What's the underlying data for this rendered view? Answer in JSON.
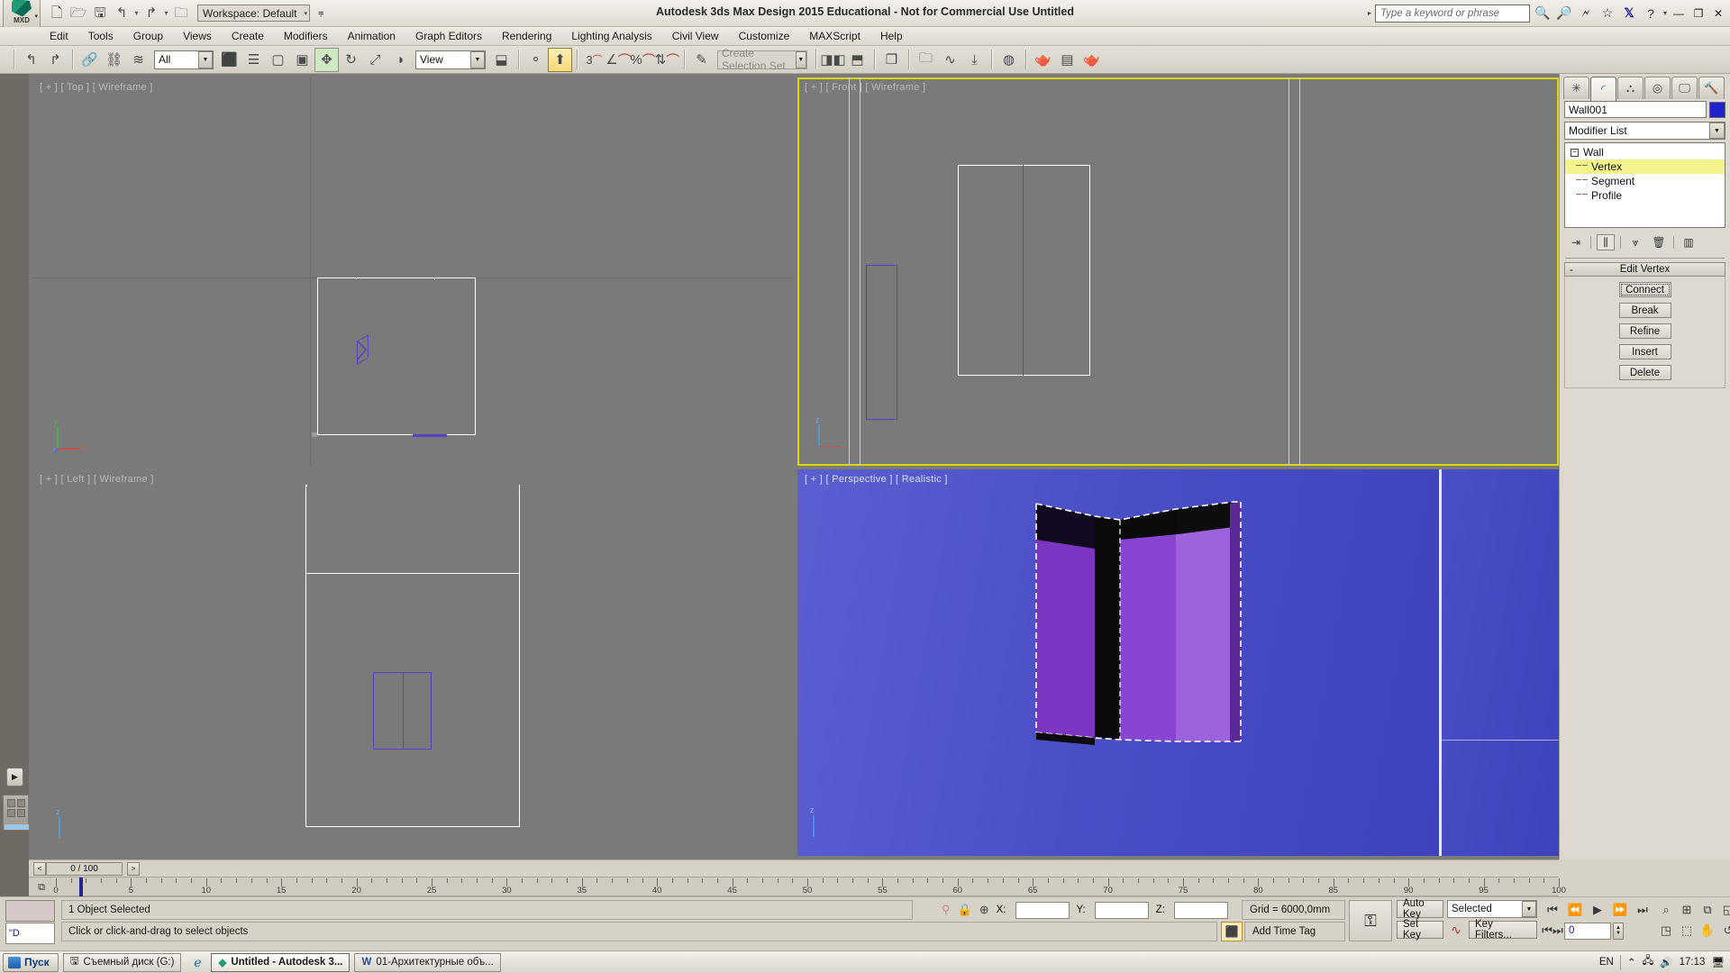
{
  "window": {
    "title": "Autodesk 3ds Max Design 2015  Educational - Not for Commercial Use   Untitled",
    "app_button_label": "MXD",
    "workspace_label": "Workspace: Default",
    "search_placeholder": "Type a keyword or phrase",
    "minimize": "—",
    "restore": "❐",
    "close": "✕"
  },
  "menu": {
    "items": [
      {
        "label": "Edit"
      },
      {
        "label": "Tools"
      },
      {
        "label": "Group"
      },
      {
        "label": "Views"
      },
      {
        "label": "Create"
      },
      {
        "label": "Modifiers"
      },
      {
        "label": "Animation"
      },
      {
        "label": "Graph Editors"
      },
      {
        "label": "Rendering"
      },
      {
        "label": "Lighting Analysis"
      },
      {
        "label": "Civil View"
      },
      {
        "label": "Customize"
      },
      {
        "label": "MAXScript"
      },
      {
        "label": "Help"
      }
    ]
  },
  "quick_access": {
    "new_icon": "new-file-icon",
    "open_icon": "open-folder-icon",
    "save_icon": "save-icon",
    "undo_icon": "undo-arrow-icon",
    "redo_icon": "redo-arrow-icon",
    "project_icon": "set-project-folder-icon"
  },
  "toolbar": {
    "selection_filter_value": "All",
    "reference_coordinate_value": "View",
    "named_selection_set_placeholder": "Create Selection Set",
    "snap_degrees": "3",
    "snap_percent": "%",
    "buttons": [
      {
        "name": "undo-button",
        "glyph": "↶"
      },
      {
        "name": "redo-button",
        "glyph": "↷"
      },
      {
        "name": "select-and-link-button",
        "glyph": "⚭"
      },
      {
        "name": "unlink-selection-button",
        "glyph": "⚭"
      },
      {
        "name": "bind-to-space-warp-button",
        "glyph": "≈"
      },
      {
        "name": "select-object-button",
        "glyph": "⬜"
      },
      {
        "name": "select-by-name-button",
        "glyph": "☰"
      },
      {
        "name": "rectangular-selection-region-button",
        "glyph": "⬚"
      },
      {
        "name": "window-crossing-button",
        "glyph": "▣"
      },
      {
        "name": "select-and-move-button",
        "glyph": "✥"
      },
      {
        "name": "select-and-rotate-button",
        "glyph": "↻"
      },
      {
        "name": "select-and-scale-button",
        "glyph": "⤢"
      },
      {
        "name": "use-center-flyout-button",
        "glyph": "◑"
      },
      {
        "name": "select-and-manipulate-button",
        "glyph": "⬤"
      },
      {
        "name": "snaps-toggle-button",
        "glyph": "⍉"
      },
      {
        "name": "angle-snap-toggle-button",
        "glyph": "∠"
      },
      {
        "name": "percent-snap-toggle-button",
        "glyph": "%"
      },
      {
        "name": "spinner-snap-toggle-button",
        "glyph": "⇅"
      },
      {
        "name": "edit-named-selection-sets-button",
        "glyph": "✎"
      },
      {
        "name": "mirror-button",
        "glyph": "▷◁"
      },
      {
        "name": "align-button",
        "glyph": "≡"
      },
      {
        "name": "layer-explorer-button",
        "glyph": "❐"
      },
      {
        "name": "scene-explorer-button",
        "glyph": "☷"
      },
      {
        "name": "curve-editor-button",
        "glyph": "∿"
      },
      {
        "name": "schematic-view-button",
        "glyph": "☰"
      },
      {
        "name": "material-editor-button",
        "glyph": "◎"
      },
      {
        "name": "render-setup-button",
        "glyph": "⛉"
      },
      {
        "name": "rendered-frame-window-button",
        "glyph": "▧"
      },
      {
        "name": "render-production-button",
        "glyph": "☕"
      }
    ]
  },
  "viewports": [
    {
      "name": "viewport-top",
      "label": "[ + ] [ Top ] [ Wireframe ]",
      "active": false
    },
    {
      "name": "viewport-front",
      "label": "[ + ] [ Front ] [ Wireframe ]",
      "active": true
    },
    {
      "name": "viewport-left",
      "label": "[ + ] [ Left ] [ Wireframe ]",
      "active": false
    },
    {
      "name": "viewport-perspective",
      "label": "[ + ] [ Perspective ] [ Realistic ]",
      "active": false
    }
  ],
  "axis_labels": {
    "x": "x",
    "y": "y",
    "z": "z"
  },
  "command_panel": {
    "tabs": [
      {
        "name": "create-tab",
        "glyph": "✻",
        "selected": false
      },
      {
        "name": "modify-tab",
        "glyph": "◜",
        "selected": true
      },
      {
        "name": "hierarchy-tab",
        "glyph": "☴",
        "selected": false
      },
      {
        "name": "motion-tab",
        "glyph": "◎",
        "selected": false
      },
      {
        "name": "display-tab",
        "glyph": "▣",
        "selected": false
      },
      {
        "name": "utilities-tab",
        "glyph": "⚒",
        "selected": false
      }
    ],
    "object_name": "Wall001",
    "object_color": "#2222cc",
    "modifier_list_label": "Modifier List",
    "modifier_stack": [
      {
        "label": "Wall",
        "level": 0,
        "highlighted": false,
        "expander": "−"
      },
      {
        "label": "Vertex",
        "level": 1,
        "highlighted": true
      },
      {
        "label": "Segment",
        "level": 1,
        "highlighted": false
      },
      {
        "label": "Profile",
        "level": 1,
        "highlighted": false
      }
    ],
    "stack_tools": [
      {
        "name": "pin-stack-button",
        "glyph": "⤅"
      },
      {
        "name": "show-end-result-button",
        "glyph": "⫼"
      },
      {
        "name": "make-unique-button",
        "glyph": "⑂"
      },
      {
        "name": "remove-modifier-button",
        "glyph": "♻"
      },
      {
        "name": "configure-modifier-sets-button",
        "glyph": "▦"
      }
    ],
    "rollout": {
      "title": "Edit Vertex",
      "minus": "-",
      "buttons": [
        {
          "label": "Connect",
          "focused": true
        },
        {
          "label": "Break",
          "focused": false
        },
        {
          "label": "Refine",
          "focused": false
        },
        {
          "label": "Insert",
          "focused": false
        },
        {
          "label": "Delete",
          "focused": false
        }
      ]
    }
  },
  "timebar": {
    "current_frame_label": "0 / 100",
    "prev_glyph": "<",
    "next_glyph": ">",
    "ruler_ticks": [
      "0",
      "5",
      "10",
      "15",
      "20",
      "25",
      "30",
      "35",
      "40",
      "45",
      "50",
      "55",
      "60",
      "65",
      "70",
      "75",
      "80",
      "85",
      "90",
      "95",
      "100"
    ]
  },
  "status": {
    "selection_text": "1 Object Selected",
    "prompt_text": "Click or click-and-drag to select objects",
    "coord_labels": {
      "x": "X:",
      "y": "Y:",
      "z": "Z:"
    },
    "coord_values": {
      "x": "",
      "y": "",
      "z": ""
    },
    "grid_text": "Grid = 6000,0mm",
    "add_time_tag": "Add Time Tag",
    "auto_key": "Auto Key",
    "set_key": "Set Key",
    "key_mode_value": "Selected",
    "key_filters": "Key Filters...",
    "frame_field_value": "0",
    "isolate_icon": "isolate-selection-icon",
    "lock_icon": "selection-lock-icon",
    "absolute_mode_icon": "absolute-relative-transform-icon",
    "key_icon": "set-key-mode-icon",
    "nav_icons": [
      {
        "name": "zoom-button",
        "glyph": "⌕"
      },
      {
        "name": "zoom-all-button",
        "glyph": "⊞"
      },
      {
        "name": "zoom-extents-button",
        "glyph": "⧉"
      },
      {
        "name": "zoom-extents-all-button",
        "glyph": "◱"
      },
      {
        "name": "field-of-view-button",
        "glyph": "◳"
      },
      {
        "name": "zoom-region-button",
        "glyph": "⬚"
      },
      {
        "name": "pan-view-button",
        "glyph": "✋"
      },
      {
        "name": "orbit-button",
        "glyph": "↺"
      },
      {
        "name": "maximize-viewport-toggle-button",
        "glyph": "⤡"
      }
    ],
    "playback_icons": [
      {
        "name": "go-to-start-button",
        "glyph": "⏮"
      },
      {
        "name": "previous-frame-button",
        "glyph": "⏪"
      },
      {
        "name": "play-animation-button",
        "glyph": "▶"
      },
      {
        "name": "next-frame-button",
        "glyph": "⏩"
      },
      {
        "name": "go-to-end-button",
        "glyph": "⏭"
      }
    ]
  },
  "taskbar": {
    "start_label": "Пуск",
    "items": [
      {
        "name": "taskbar-item-removable-disk",
        "label": "Съемный диск (G:)",
        "active": false,
        "icon": "drive-icon"
      },
      {
        "name": "taskbar-item-3dsmax",
        "label": "Untitled - Autodesk 3...",
        "active": true,
        "icon": "3dsmax-icon"
      },
      {
        "name": "taskbar-item-word",
        "label": "01-Архитектурные объ...",
        "active": false,
        "icon": "word-icon"
      }
    ],
    "quicklaunch_icon": "internet-explorer-icon",
    "tray": {
      "language": "EN",
      "clock": "17:13",
      "icons": [
        "show-hidden-icon",
        "network-icon",
        "volume-icon",
        "display-icon"
      ]
    }
  }
}
